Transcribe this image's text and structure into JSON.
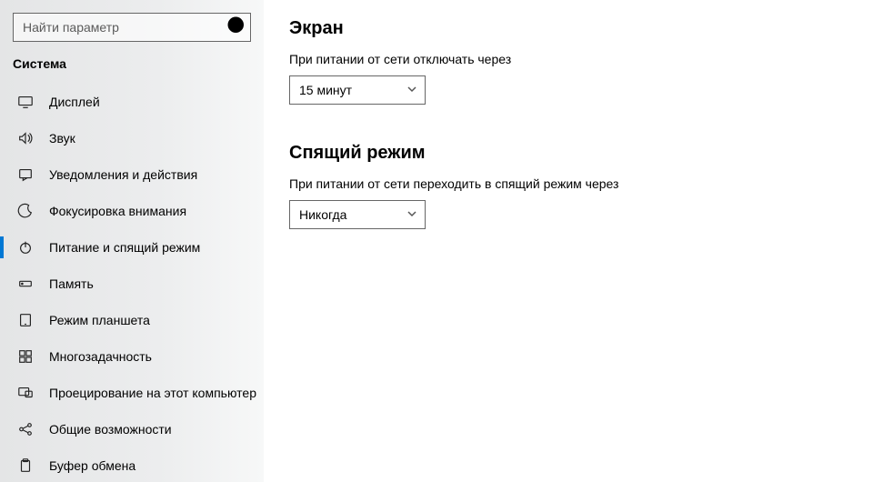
{
  "search": {
    "placeholder": "Найти параметр"
  },
  "sidebar": {
    "category": "Система",
    "items": [
      {
        "label": "Дисплей"
      },
      {
        "label": "Звук"
      },
      {
        "label": "Уведомления и действия"
      },
      {
        "label": "Фокусировка внимания"
      },
      {
        "label": "Питание и спящий режим"
      },
      {
        "label": "Память"
      },
      {
        "label": "Режим планшета"
      },
      {
        "label": "Многозадачность"
      },
      {
        "label": "Проецирование на этот компьютер"
      },
      {
        "label": "Общие возможности"
      },
      {
        "label": "Буфер обмена"
      }
    ],
    "active_index": 4
  },
  "main": {
    "screen": {
      "heading": "Экран",
      "label": "При питании от сети отключать через",
      "value": "15 минут"
    },
    "sleep": {
      "heading": "Спящий режим",
      "label": "При питании от сети переходить в спящий режим через",
      "value": "Никогда"
    }
  }
}
